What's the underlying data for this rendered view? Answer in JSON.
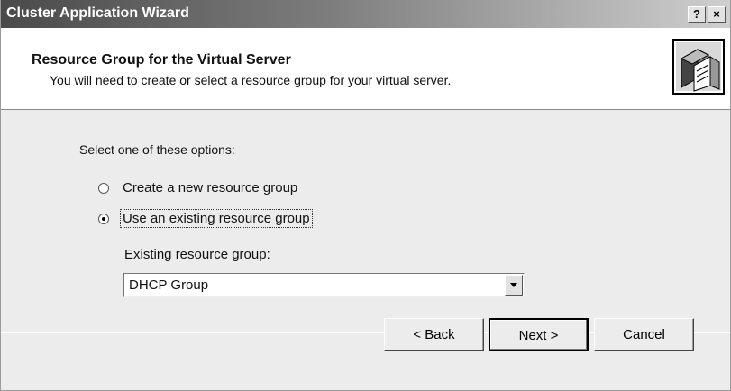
{
  "window": {
    "title": "Cluster Application Wizard",
    "help_label": "?",
    "close_label": "×"
  },
  "header": {
    "title": "Resource Group for the Virtual Server",
    "subtitle": "You will need to create or select a resource group for your virtual server."
  },
  "options": {
    "prompt": "Select one of these options:",
    "items": [
      {
        "label": "Create a new resource group",
        "checked": false
      },
      {
        "label": "Use an existing resource group",
        "checked": true
      }
    ]
  },
  "existing_group": {
    "label": "Existing resource group:",
    "value": "DHCP Group"
  },
  "footer": {
    "back_label": "< Back",
    "next_label": "Next >",
    "cancel_label": "Cancel"
  },
  "icons": {
    "wizard_icon": "server-cluster-icon",
    "dropdown_icon": "chevron-down-icon"
  }
}
